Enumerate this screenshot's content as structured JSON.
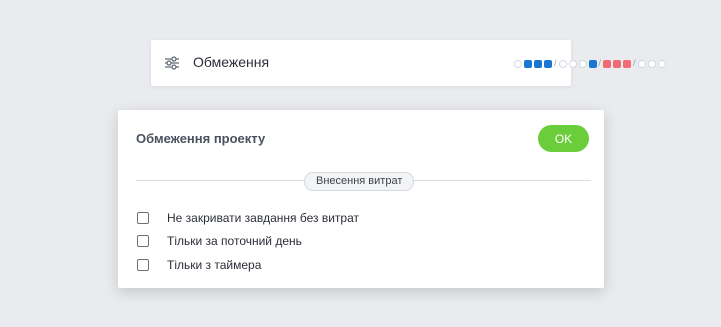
{
  "topbar": {
    "icon": "sliders-icon",
    "label": "Обмеження",
    "indicator": [
      {
        "kind": "empty"
      },
      {
        "kind": "blue"
      },
      {
        "kind": "blue"
      },
      {
        "kind": "blue"
      },
      {
        "kind": "sep"
      },
      {
        "kind": "empty"
      },
      {
        "kind": "empty"
      },
      {
        "kind": "empty"
      },
      {
        "kind": "blue"
      },
      {
        "kind": "sep"
      },
      {
        "kind": "red"
      },
      {
        "kind": "red"
      },
      {
        "kind": "red"
      },
      {
        "kind": "sep"
      },
      {
        "kind": "empty"
      },
      {
        "kind": "empty"
      },
      {
        "kind": "empty"
      }
    ],
    "separator_char": "/"
  },
  "panel": {
    "title": "Обмеження проекту",
    "ok_label": "OK",
    "section_label": "Внесення витрат",
    "options": [
      {
        "label": "Не закривати завдання без витрат",
        "checked": false
      },
      {
        "label": "Тільки за поточний день",
        "checked": false
      },
      {
        "label": "Тільки з таймера",
        "checked": false
      }
    ]
  },
  "colors": {
    "background": "#e9ebee",
    "accent_green": "#6ccd3b",
    "indicator_blue": "#1976d2",
    "indicator_red": "#ef6c74"
  }
}
